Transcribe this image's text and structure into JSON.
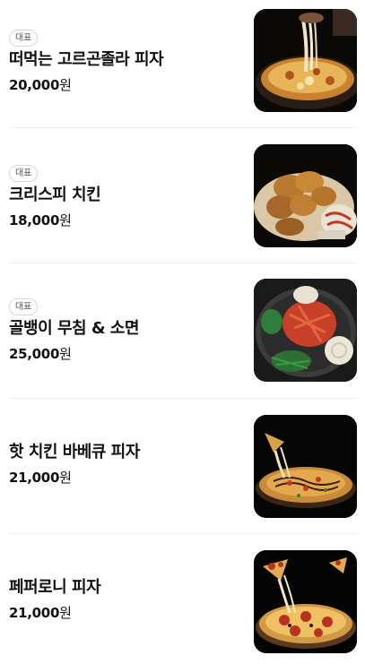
{
  "menu": {
    "items": [
      {
        "badge": "대표",
        "name": "떠먹는 고르곤졸라 피자",
        "price": "20,000",
        "currency": "원",
        "image": "gorgonzola-pizza-photo"
      },
      {
        "badge": "대표",
        "name": "크리스피 치킨",
        "price": "18,000",
        "currency": "원",
        "image": "crispy-chicken-photo"
      },
      {
        "badge": "대표",
        "name": "골뱅이 무침 & 소면",
        "price": "25,000",
        "currency": "원",
        "image": "golbaengi-noodle-photo"
      },
      {
        "name": "핫 치킨 바베큐 피자",
        "price": "21,000",
        "currency": "원",
        "image": "bbq-pizza-photo"
      },
      {
        "name": "페퍼로니 피자",
        "price": "21,000",
        "currency": "원",
        "image": "pepperoni-pizza-photo"
      }
    ]
  }
}
